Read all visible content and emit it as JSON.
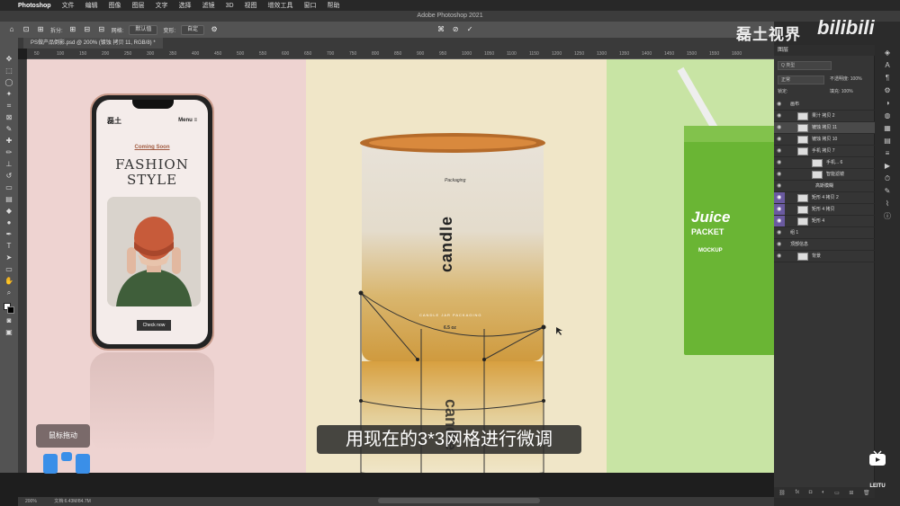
{
  "menubar": {
    "apple": "",
    "items": [
      "Photoshop",
      "文件",
      "编辑",
      "图像",
      "图层",
      "文字",
      "选择",
      "滤镜",
      "3D",
      "视图",
      "增效工具",
      "窗口",
      "帮助"
    ]
  },
  "title": "Adobe Photoshop 2021",
  "options": {
    "split_label": "拆分:",
    "grid_label": "网格:",
    "grid_value": "默认值",
    "warp_label": "变形:",
    "warp_value": "自定"
  },
  "document_tab": "PS做产品倒影.psd @ 200% (镀蚀 拷贝 11, RGB/8) *",
  "ruler_ticks": [
    "50",
    "100",
    "150",
    "200",
    "250",
    "300",
    "350",
    "400",
    "450",
    "500",
    "550",
    "600",
    "650",
    "700",
    "750",
    "800",
    "850",
    "900",
    "950",
    "1000",
    "1050",
    "1100",
    "1150",
    "1200",
    "1250",
    "1300",
    "1350",
    "1400",
    "1450",
    "1500",
    "1550",
    "1600"
  ],
  "phone": {
    "logo": "磊土",
    "menu": "Menu ≡",
    "coming": "Coming Soon",
    "line1": "FASHION",
    "line2": "STYLE",
    "button": "Check now"
  },
  "candle": {
    "brand": "Packaging",
    "word": "candle",
    "jar": "CANDLE JAR PACKAGING",
    "oz": "6.5 oz",
    "reflection_word": "candle"
  },
  "juice": {
    "title1": "Juice",
    "title2": "PACKET",
    "sub": "MOCKUP"
  },
  "status": {
    "zoom": "200%",
    "doc": "文档:6.43M/84.7M"
  },
  "layers_panel": {
    "title": "图层",
    "kind": "Q 类型",
    "blend": "正常",
    "opacity_label": "不透明度:",
    "opacity_value": "100%",
    "lock_label": "锁定:",
    "fill_label": "填充:",
    "fill_value": "100%",
    "layers": [
      {
        "name": "画布",
        "indent": 14,
        "thumb": false,
        "selected": false,
        "purple": false
      },
      {
        "name": "果汁 拷贝 2",
        "indent": 26,
        "thumb": true,
        "selected": false,
        "purple": false
      },
      {
        "name": "镀蚀 拷贝 11",
        "indent": 26,
        "thumb": true,
        "selected": true,
        "purple": false
      },
      {
        "name": "镀蚀 拷贝 10",
        "indent": 26,
        "thumb": true,
        "selected": false,
        "purple": false
      },
      {
        "name": "手机 拷贝 7",
        "indent": 26,
        "thumb": true,
        "selected": false,
        "purple": false
      },
      {
        "name": "手机... 6",
        "indent": 42,
        "thumb": true,
        "selected": false,
        "purple": false
      },
      {
        "name": "智能滤镜",
        "indent": 42,
        "thumb": true,
        "selected": false,
        "purple": false
      },
      {
        "name": "高斯模糊",
        "indent": 42,
        "thumb": false,
        "selected": false,
        "purple": false
      },
      {
        "name": "矩形 4 拷贝 2",
        "indent": 26,
        "thumb": true,
        "selected": false,
        "purple": true
      },
      {
        "name": "矩形 4 拷贝",
        "indent": 26,
        "thumb": true,
        "selected": false,
        "purple": true
      },
      {
        "name": "矩形 4",
        "indent": 26,
        "thumb": true,
        "selected": false,
        "purple": true
      },
      {
        "name": "组 1",
        "indent": 14,
        "thumb": false,
        "selected": false,
        "purple": false
      },
      {
        "name": "顶部信息",
        "indent": 14,
        "thumb": false,
        "selected": false,
        "purple": false
      },
      {
        "name": "背景",
        "indent": 26,
        "thumb": true,
        "selected": false,
        "purple": false
      }
    ]
  },
  "overlays": {
    "watermark": "磊土视界",
    "bili": "bilibili",
    "mouse_hint": "鼠标拖动",
    "subtitle": "用现在的3*3网格进行微调",
    "leitu": "LEITU"
  },
  "colors": {
    "pink": "#eed3d1",
    "cream": "#f0e6c8",
    "green": "#c8e4a4",
    "accent_blue": "#3a8fe8"
  }
}
